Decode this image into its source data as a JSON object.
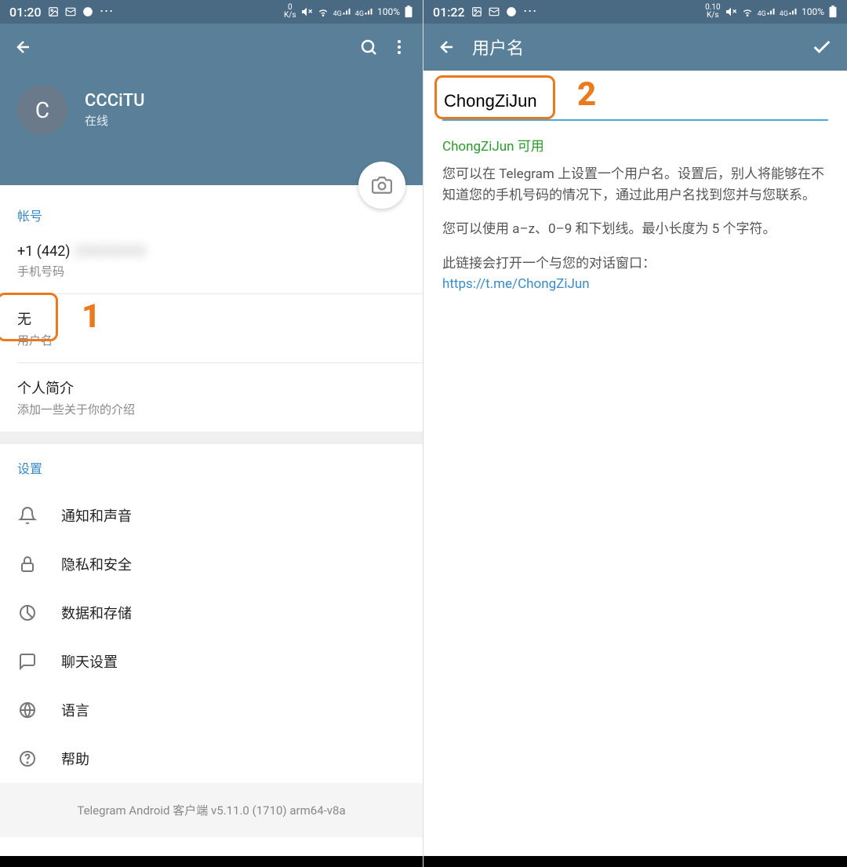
{
  "left": {
    "status": {
      "time": "01:20",
      "speed_top": "0",
      "speed_unit": "K/s",
      "battery": "100%"
    },
    "profile": {
      "avatar_letter": "C",
      "name": "CCCiTU",
      "status": "在线"
    },
    "account": {
      "section_title": "帐号",
      "phone_prefix": "+1 (442)",
      "phone_rest": "2XXXXXX",
      "phone_label": "手机号码",
      "username_value": "无",
      "username_label": "用户名",
      "bio_title": "个人简介",
      "bio_hint": "添加一些关于你的介绍"
    },
    "settings": {
      "section_title": "设置",
      "items": [
        {
          "id": "notifications",
          "label": "通知和声音"
        },
        {
          "id": "privacy",
          "label": "隐私和安全"
        },
        {
          "id": "data",
          "label": "数据和存储"
        },
        {
          "id": "chat",
          "label": "聊天设置"
        },
        {
          "id": "language",
          "label": "语言"
        },
        {
          "id": "help",
          "label": "帮助"
        }
      ]
    },
    "footer": "Telegram Android 客户端 v5.11.0 (1710) arm64-v8a",
    "annotation_num": "1"
  },
  "right": {
    "status": {
      "time": "01:22",
      "speed_top": "0.10",
      "speed_unit": "K/s",
      "battery": "100%"
    },
    "title": "用户名",
    "username": "ChongZiJun",
    "available": "ChongZiJun 可用",
    "desc1": "您可以在 Telegram 上设置一个用户名。设置后，别人将能够在不知道您的手机号码的情况下，通过此用户名找到您并与您联系。",
    "desc2": "您可以使用 a–z、0–9 和下划线。最小长度为 5 个字符。",
    "desc3": "此链接会打开一个与您的对话窗口：",
    "link": "https://t.me/ChongZiJun",
    "annotation_num": "2"
  }
}
